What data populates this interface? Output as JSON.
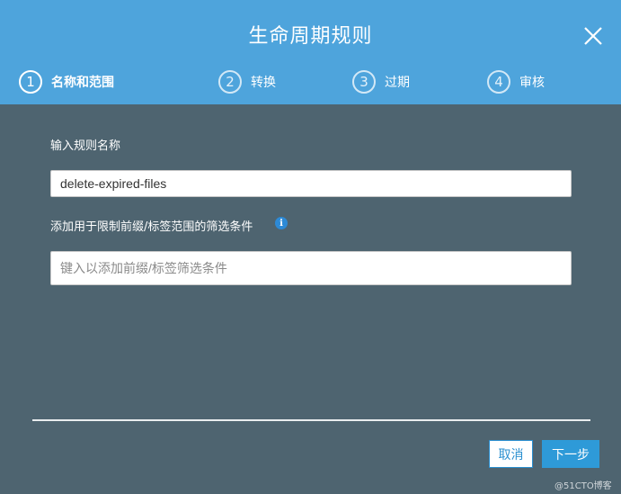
{
  "dialog": {
    "title": "生命周期规则",
    "close_icon": "close-icon"
  },
  "steps": [
    {
      "number": "1",
      "label": "名称和范围",
      "active": true
    },
    {
      "number": "2",
      "label": "转换",
      "active": false
    },
    {
      "number": "3",
      "label": "过期",
      "active": false
    },
    {
      "number": "4",
      "label": "审核",
      "active": false
    }
  ],
  "form": {
    "rule_name_label": "输入规则名称",
    "rule_name_value": "delete-expired-files",
    "filter_label": "添加用于限制前缀/标签范围的筛选条件",
    "filter_placeholder": "键入以添加前缀/标签筛选条件",
    "info_icon": "i"
  },
  "footer": {
    "cancel_label": "取消",
    "next_label": "下一步"
  },
  "watermark": "@51CTO博客",
  "colors": {
    "header": "#4ea4dc",
    "body": "#4e6470",
    "primary": "#2e9ad8"
  }
}
